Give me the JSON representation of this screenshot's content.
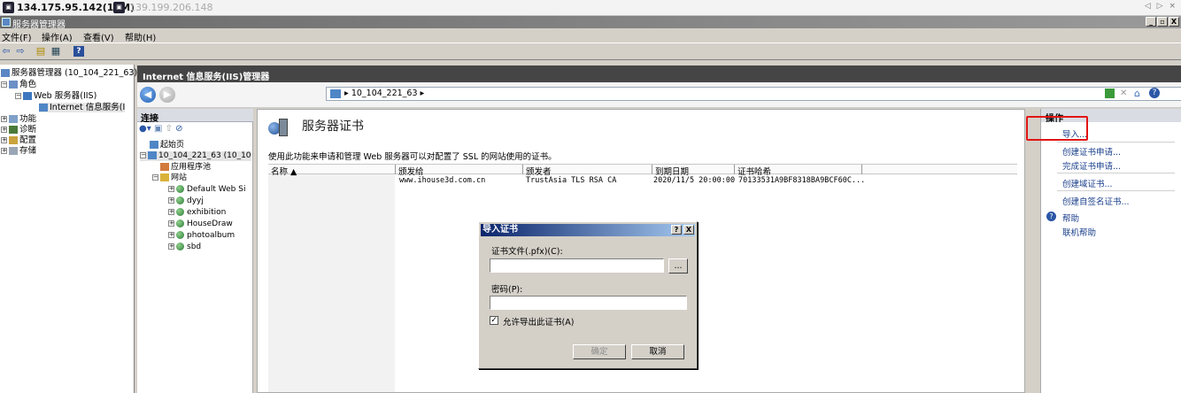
{
  "rdp": {
    "host1": "134.175.95.142(10M)",
    "host2": "139.199.206.148",
    "controls": "◁ ▷ ×"
  },
  "window": {
    "title": "服务器管理器",
    "min": "_",
    "restore": "🗗",
    "close": "X"
  },
  "menu": [
    "文件(F)",
    "操作(A)",
    "查看(V)",
    "帮助(H)"
  ],
  "tree": {
    "root": "服务器管理器 (10_104_221_63)",
    "roles": "角色",
    "web_server": "Web 服务器(IIS)",
    "iis_manager": "Internet 信息服务(I",
    "features": "功能",
    "diagnostics": "诊断",
    "config": "配置",
    "storage": "存储"
  },
  "iis": {
    "header": "Internet 信息服务(IIS)管理器",
    "address": "10_104_221_63",
    "address_sep": "▸"
  },
  "connections": {
    "title": "连接",
    "start_page": "起始页",
    "server": "10_104_221_63 (10_10",
    "app_pools": "应用程序池",
    "sites": "网站",
    "site_list": [
      "Default Web Si",
      "dyyj",
      "exhibition",
      "HouseDraw",
      "photoalbum",
      "sbd"
    ]
  },
  "main": {
    "title": "服务器证书",
    "description": "使用此功能来申请和管理 Web 服务器可以对配置了 SSL 的网站使用的证书。",
    "columns": [
      "名称 ▲",
      "颁发给",
      "颁发者",
      "到期日期",
      "证书哈希"
    ],
    "rows": [
      {
        "name": "",
        "issued_to": "www.ihouse3d.com.cn",
        "issuer": "TrustAsia TLS RSA CA",
        "expires": "2020/11/5 20:00:00",
        "hash": "70133531A9BF8318BA9BCF60C..."
      }
    ]
  },
  "actions": {
    "title": "操作",
    "import": "导入...",
    "create_request": "创建证书申请...",
    "complete_request": "完成证书申请...",
    "create_domain": "创建域证书...",
    "create_selfsigned": "创建自签名证书...",
    "help": "帮助",
    "online_help": "联机帮助"
  },
  "dialog": {
    "title": "导入证书",
    "help_btn": "?",
    "close_btn": "X",
    "file_label": "证书文件(.pfx)(C):",
    "browse": "...",
    "password_label": "密码(P):",
    "allow_export": "允许导出此证书(A)",
    "ok": "确定",
    "cancel": "取消",
    "checkbox_checked": true
  },
  "colors": {
    "accent_red": "#e21515",
    "link": "#1a3f8b",
    "dialog_title": "#0a246a"
  }
}
